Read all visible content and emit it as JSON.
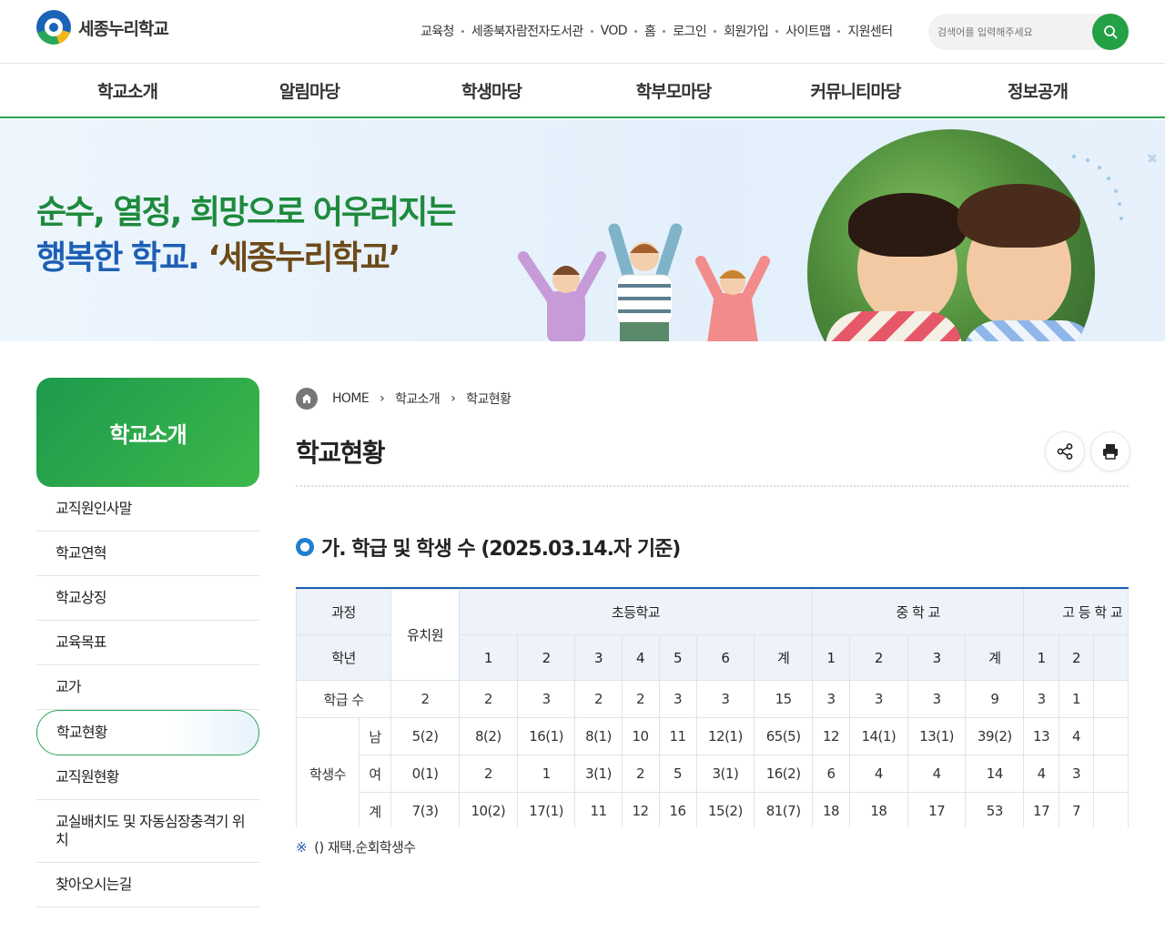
{
  "header": {
    "logo_text": "세종누리학교",
    "util_links": [
      "교육청",
      "세종북자람전자도서관",
      "VOD",
      "홈",
      "로그인",
      "회원가입",
      "사이트맵",
      "지원센터"
    ],
    "search_placeholder": "검색어를 입력해주세요"
  },
  "gnb": [
    "학교소개",
    "알림마당",
    "학생마당",
    "학부모마당",
    "커뮤니티마당",
    "정보공개"
  ],
  "banner": {
    "line1": "순수, 열정, 희망으로 어우러지는",
    "line2_blue": "행복한 학교.",
    "line2_brown": "‘세종누리학교’"
  },
  "sidebar": {
    "title": "학교소개",
    "items": [
      "교직원인사말",
      "학교연혁",
      "학교상징",
      "교육목표",
      "교가",
      "학교현황",
      "교직원현황",
      "교실배치도 및 자동심장충격기 위치",
      "찾아오시는길"
    ]
  },
  "breadcrumb": [
    "HOME",
    "학교소개",
    "학교현황"
  ],
  "page_title": "학교현황",
  "section_title": "가. 학급 및 학생 수 (2025.03.14.자 기준)",
  "table": {
    "h_course": "과정",
    "h_kinder": "유치원",
    "h_elem": "초등학교",
    "h_middle": "중 학 교",
    "h_high": "고 등 학 교",
    "h_grade": "학년",
    "elem_grades": [
      "1",
      "2",
      "3",
      "4",
      "5",
      "6",
      "계"
    ],
    "middle_grades": [
      "1",
      "2",
      "3",
      "계"
    ],
    "high_grades": [
      "1",
      "2"
    ],
    "row_classes_label": "학급 수",
    "row_students_label": "학생수",
    "row_male": "남",
    "row_female": "여",
    "row_total": "계",
    "classes": [
      "2",
      "2",
      "3",
      "2",
      "2",
      "3",
      "3",
      "15",
      "3",
      "3",
      "3",
      "9",
      "3",
      "1"
    ],
    "male": [
      "5(2)",
      "8(2)",
      "16(1)",
      "8(1)",
      "10",
      "11",
      "12(1)",
      "65(5)",
      "12",
      "14(1)",
      "13(1)",
      "39(2)",
      "13",
      "4"
    ],
    "female": [
      "0(1)",
      "2",
      "1",
      "3(1)",
      "2",
      "5",
      "3(1)",
      "16(2)",
      "6",
      "4",
      "4",
      "14",
      "4",
      "3"
    ],
    "total": [
      "7(3)",
      "10(2)",
      "17(1)",
      "11",
      "12",
      "16",
      "15(2)",
      "81(7)",
      "18",
      "18",
      "17",
      "53",
      "17",
      "7"
    ]
  },
  "note_mark": "※",
  "note": "() 재택.순회학생수"
}
